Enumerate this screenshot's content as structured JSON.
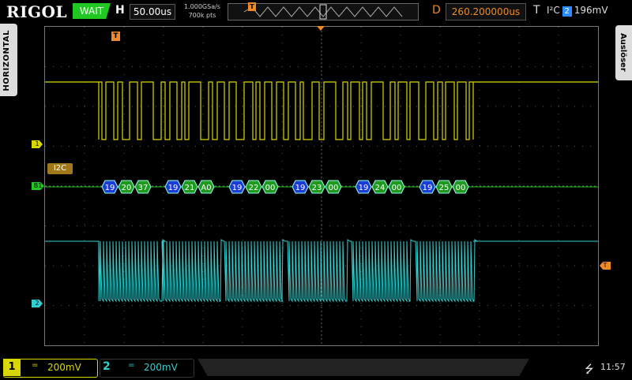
{
  "brand": "RIGOL",
  "status": "WAIT",
  "horizontal": {
    "label": "H",
    "timebase": "50.00us",
    "sample_rate": "1.000GSa/s",
    "memory_depth": "700k pts",
    "delay_label": "D",
    "delay": "260.200000us"
  },
  "trigger": {
    "label": "T",
    "type": "I²C",
    "source": "2",
    "level": "196mV",
    "marker": "T"
  },
  "side_tabs": {
    "left": "HORIZONTAL",
    "right": "Auslöser"
  },
  "decode": {
    "bus_label": "I2C",
    "bus_marker": "B1",
    "frames": [
      {
        "value": "19",
        "kind": "address"
      },
      {
        "value": "20",
        "kind": "data"
      },
      {
        "value": "37",
        "kind": "data"
      },
      {
        "value": "19",
        "kind": "address"
      },
      {
        "value": "21",
        "kind": "data"
      },
      {
        "value": "A0",
        "kind": "data"
      },
      {
        "value": "19",
        "kind": "address"
      },
      {
        "value": "22",
        "kind": "data"
      },
      {
        "value": "00",
        "kind": "data"
      },
      {
        "value": "19",
        "kind": "address"
      },
      {
        "value": "23",
        "kind": "data"
      },
      {
        "value": "00",
        "kind": "data"
      },
      {
        "value": "19",
        "kind": "address"
      },
      {
        "value": "24",
        "kind": "data"
      },
      {
        "value": "00",
        "kind": "data"
      },
      {
        "value": "19",
        "kind": "address"
      },
      {
        "value": "25",
        "kind": "data"
      },
      {
        "value": "00",
        "kind": "data"
      }
    ]
  },
  "channels": {
    "ch1": {
      "number": "1",
      "coupling": "=",
      "scale": "200mV",
      "color": "#d8d800"
    },
    "ch2": {
      "number": "2",
      "coupling": "=",
      "scale": "200mV",
      "color": "#2fd0d0"
    }
  },
  "colors": {
    "address_frame": "#1a3cd8",
    "data_frame": "#1f9a1f",
    "bus_line": "#22c822",
    "trigger": "#f08a24",
    "status_bg": "#22c822"
  },
  "system": {
    "usb_icon": "usb-icon",
    "time": "11:57"
  }
}
